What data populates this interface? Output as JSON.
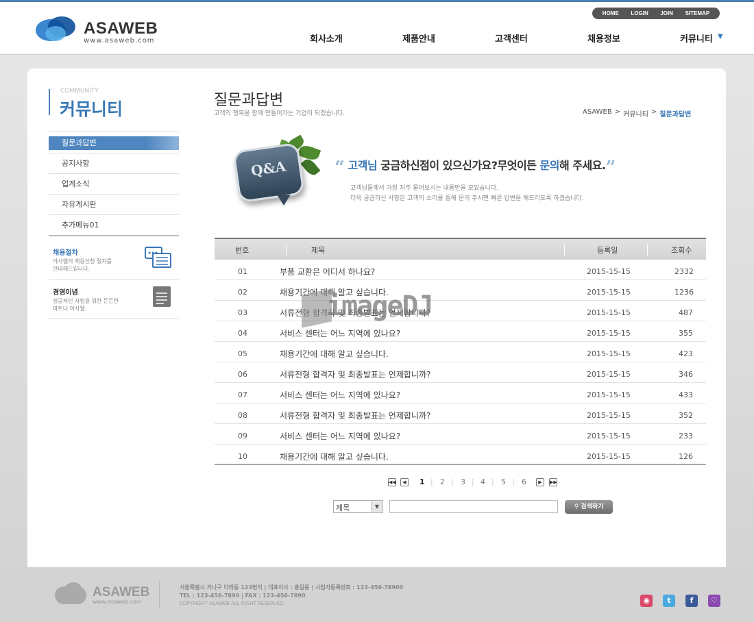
{
  "header": {
    "logo_name": "ASAWEB",
    "logo_url": "www.asaweb.com",
    "util": [
      "HOME",
      "LOGIN",
      "JOIN",
      "SITEMAP"
    ],
    "gnb": [
      "회사소개",
      "제품안내",
      "고객센터",
      "채용정보",
      "커뮤니티"
    ],
    "more_icon": "chevron-down-icon"
  },
  "sidebar": {
    "title_en": "COMMUNITY",
    "title_ko": "커뮤니티",
    "items": [
      "질문과답변",
      "공지사항",
      "업계소식",
      "자유게시판",
      "추가메뉴01"
    ],
    "banners": [
      {
        "title": "채용절차",
        "desc1": "아사웹의 채용신청 절차를",
        "desc2": "안내해드립니다.",
        "icon": "checklist-icon"
      },
      {
        "title": "경영이념",
        "desc1": "성공적인 사업을 위한 든든한",
        "desc2": "파트너 아사웹.",
        "icon": "document-icon"
      }
    ]
  },
  "main": {
    "title": "질문과답변",
    "subtitle": "고객의 행복을 함께 만들어가는 기업이 되겠습니다.",
    "breadcrumb": [
      "ASAWEB",
      ">",
      "커뮤니티",
      ">",
      "질문과답변"
    ],
    "qa_label": "Q&A",
    "intro_q_open": "“",
    "intro_q_close": "”",
    "intro_parts": [
      "고객님",
      " 궁금하신점이 있으신가요?무엇이든 ",
      "문의",
      "해 주세요."
    ],
    "intro_line1": "고객님들께서 가장 자주 물어보시는 내용만을 모았습니다.",
    "intro_line2": "더욱 궁금하신 사항은 고객의 소리를 통해 문의 주시면 빠른 답변을 해드리도록 하겠습니다."
  },
  "table": {
    "headers": [
      "번호",
      "제목",
      "등록일",
      "조회수"
    ],
    "rows": [
      {
        "no": "01",
        "title": "부품 교환은 어디서 하나요?",
        "date": "2015-15-15",
        "views": "2332"
      },
      {
        "no": "02",
        "title": "채용기간에 대해 알고 싶습니다.",
        "date": "2015-15-15",
        "views": "1236"
      },
      {
        "no": "03",
        "title": "서류전형 합격자 및 최종발표는 언제합니까?",
        "date": "2015-15-15",
        "views": "487"
      },
      {
        "no": "04",
        "title": "서비스 센터는 어느 지역에 있나요?",
        "date": "2015-15-15",
        "views": "355"
      },
      {
        "no": "05",
        "title": "채용기간에 대해 알고 싶습니다.",
        "date": "2015-15-15",
        "views": "423"
      },
      {
        "no": "06",
        "title": "서류전형 합격자 및 최종발표는 언제합니까?",
        "date": "2015-15-15",
        "views": "346"
      },
      {
        "no": "07",
        "title": "서비스 센터는 어느 지역에 있나요?",
        "date": "2015-15-15",
        "views": "433"
      },
      {
        "no": "08",
        "title": "서류전형 합격자 및 최종발표는 언제합니까?",
        "date": "2015-15-15",
        "views": "352"
      },
      {
        "no": "09",
        "title": "서비스 센터는 어느 지역에 있나요?",
        "date": "2015-15-15",
        "views": "233"
      },
      {
        "no": "10",
        "title": "채용기간에 대해 알고 싶습니다.",
        "date": "2015-15-15",
        "views": "126"
      }
    ]
  },
  "pagination": {
    "pages": [
      "1",
      "2",
      "3",
      "4",
      "5",
      "6"
    ],
    "current": "1",
    "icons": [
      "first-page-icon",
      "prev-page-icon",
      "next-page-icon",
      "last-page-icon"
    ]
  },
  "search": {
    "select_value": "제목",
    "input_value": "",
    "button_label": "검색하기",
    "button_icon": "search-icon"
  },
  "watermark": "imageDJ",
  "footer": {
    "logo_name": "ASAWEB",
    "logo_url": "www.asaweb.com",
    "line1": "서울특별시 가나구 다라동 123번지  |  대표이사 : 홍길동  |  사업자등록번호 : 123-456-78900",
    "line2": "TEL : 123-456-7890  |  FAX : 123-456-7890",
    "line3": "COPYRIGHT ASAWEB ALL RIGHT RESERVED.",
    "sns": [
      "instagram-icon",
      "twitter-icon",
      "facebook-icon",
      "messenger-icon"
    ]
  }
}
